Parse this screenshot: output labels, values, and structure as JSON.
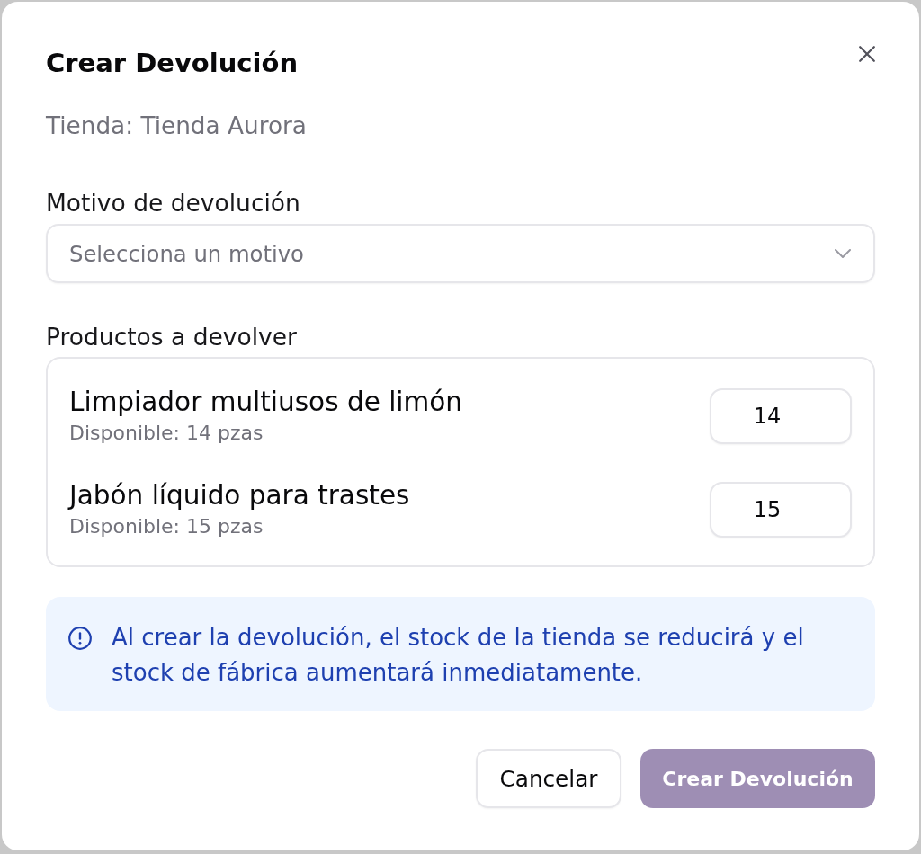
{
  "dialog": {
    "title": "Crear Devolución",
    "subtitle": "Tienda: Tienda Aurora"
  },
  "reason": {
    "label": "Motivo de devolución",
    "placeholder": "Selecciona un motivo"
  },
  "products": {
    "label": "Productos a devolver",
    "items": [
      {
        "name": "Limpiador multiusos de limón",
        "availability": "Disponible: 14 pzas",
        "quantity": "14"
      },
      {
        "name": "Jabón líquido para trastes",
        "availability": "Disponible: 15 pzas",
        "quantity": "15"
      }
    ]
  },
  "notice": {
    "text": "Al crear la devolución, el stock de la tienda se reducirá y el stock de fábrica aumentará inmediatamente."
  },
  "buttons": [
    {
      "label": "Cancelar",
      "kind": "secondary",
      "disabled": false
    },
    {
      "label": "Crear Devolución",
      "kind": "primary",
      "disabled": true
    }
  ]
}
